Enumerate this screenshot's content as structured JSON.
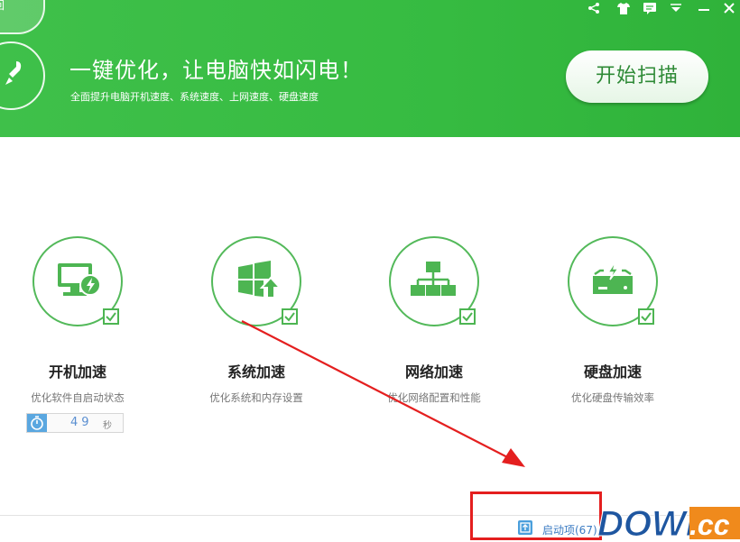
{
  "window": {
    "back_label": "回"
  },
  "header": {
    "title": "一键优化，让电脑快如闪电！",
    "subtitle": "全面提升电脑开机速度、系统速度、上网速度、硬盘速度",
    "scan_button": "开始扫描"
  },
  "top_icons": [
    "share-icon",
    "tshirt-icon",
    "message-icon",
    "dropdown-icon",
    "minimize-icon",
    "close-icon"
  ],
  "cards": [
    {
      "title": "开机加速",
      "desc": "优化软件自启动状态",
      "icon": "monitor-bolt-icon",
      "checked": true
    },
    {
      "title": "系统加速",
      "desc": "优化系统和内存设置",
      "icon": "windows-up-icon",
      "checked": true
    },
    {
      "title": "网络加速",
      "desc": "优化网络配置和性能",
      "icon": "network-icon",
      "checked": true
    },
    {
      "title": "硬盘加速",
      "desc": "优化硬盘传输效率",
      "icon": "disk-bolt-icon",
      "checked": true
    }
  ],
  "boot_timer": {
    "value": "49",
    "unit": "秒"
  },
  "startup_items": {
    "label": "启动项(67)"
  },
  "watermark": {
    "text_a": "DOWN",
    "text_b": ".cc"
  },
  "colors": {
    "brand_green": "#36bb41",
    "annotation_red": "#e41f1f"
  }
}
